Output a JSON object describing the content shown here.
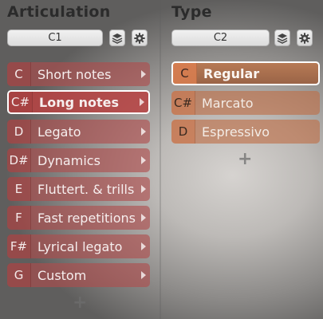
{
  "articulation": {
    "title": "Articulation",
    "selector_value": "C1",
    "items": [
      {
        "key": "C",
        "label": "Short notes",
        "active": false
      },
      {
        "key": "C#",
        "label": "Long notes",
        "active": true
      },
      {
        "key": "D",
        "label": "Legato",
        "active": false
      },
      {
        "key": "D#",
        "label": "Dynamics",
        "active": false
      },
      {
        "key": "E",
        "label": "Fluttert. & trills",
        "active": false
      },
      {
        "key": "F",
        "label": "Fast repetitions",
        "active": false
      },
      {
        "key": "F#",
        "label": "Lyrical legato",
        "active": false
      },
      {
        "key": "G",
        "label": "Custom",
        "active": false
      }
    ],
    "add_symbol": "+"
  },
  "type": {
    "title": "Type",
    "selector_value": "C2",
    "items": [
      {
        "key": "C",
        "label": "Regular",
        "active": true
      },
      {
        "key": "C#",
        "label": "Marcato",
        "active": false
      },
      {
        "key": "D",
        "label": "Espressivo",
        "active": false
      }
    ],
    "add_symbol": "+"
  },
  "colors": {
    "articulation_row": "#b04c4c",
    "type_row": "#be6e46",
    "active_border": "#ffffff"
  },
  "icons": [
    "layers-icon",
    "gear-icon",
    "chevron-right-icon",
    "plus-icon"
  ]
}
